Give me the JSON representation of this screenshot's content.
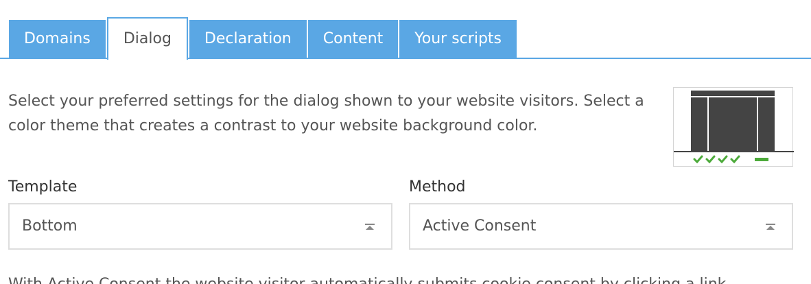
{
  "tabs": [
    {
      "label": "Domains",
      "active": false
    },
    {
      "label": "Dialog",
      "active": true
    },
    {
      "label": "Declaration",
      "active": false
    },
    {
      "label": "Content",
      "active": false
    },
    {
      "label": "Your scripts",
      "active": false
    }
  ],
  "description": "Select your preferred settings for the dialog shown to your website visitors. Select a color theme that creates a contrast to your website background color.",
  "preview": {
    "icon": "bottom-template-preview-icon"
  },
  "template_field": {
    "label": "Template",
    "value": "Bottom"
  },
  "method_field": {
    "label": "Method",
    "value": "Active Consent"
  },
  "bottom_text": "With Active Consent the website visitor automatically submits cookie consent by clicking a link...",
  "colors": {
    "accent": "#5aa7e4",
    "check_green": "#4caa3a"
  }
}
